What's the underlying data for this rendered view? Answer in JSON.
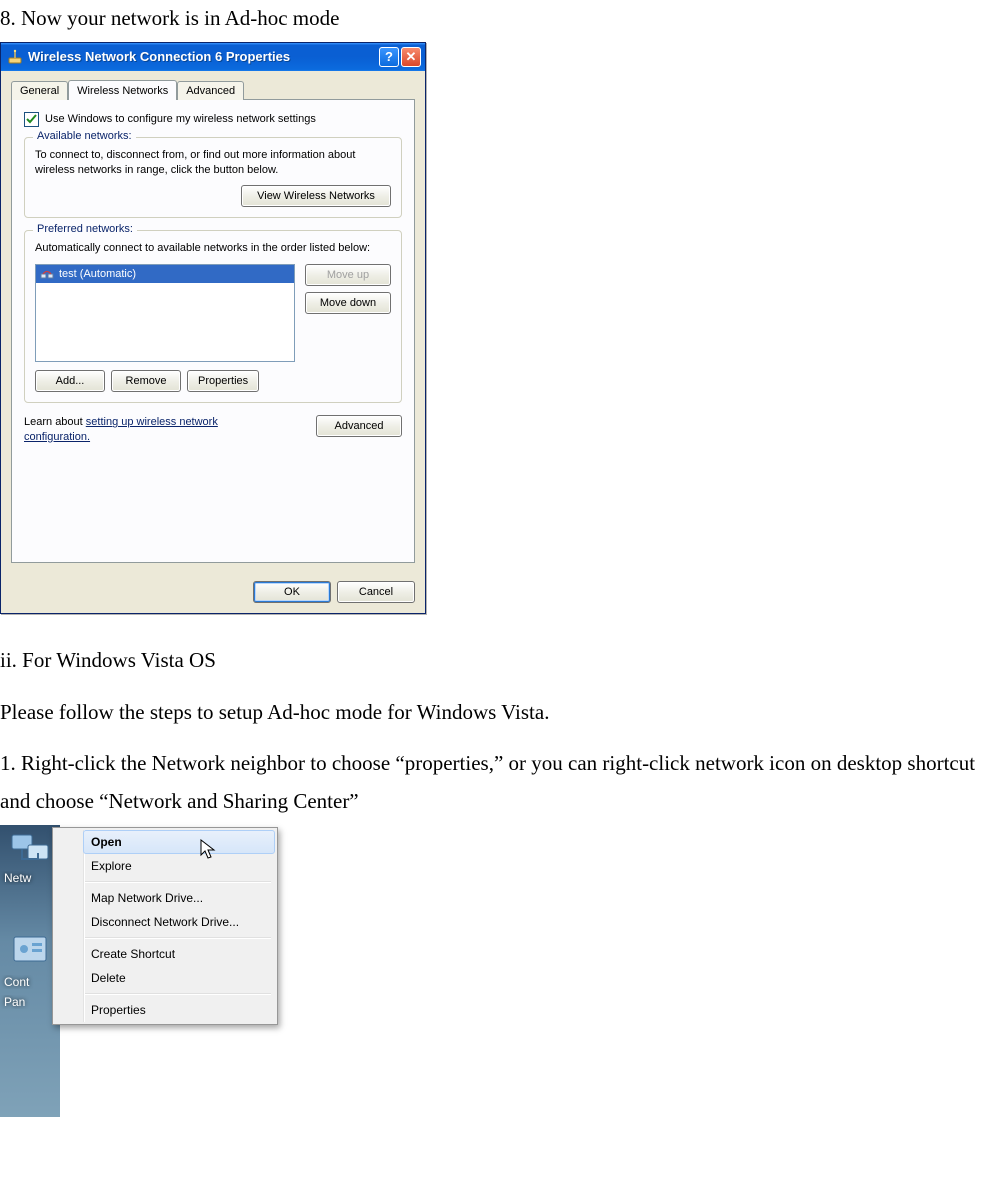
{
  "doc": {
    "step8": "8. Now your network is in Ad-hoc mode",
    "vista_heading": "ii. For Windows Vista OS",
    "vista_intro": "Please follow the steps to setup Ad-hoc mode for Windows Vista.",
    "vista_step1": "1. Right-click the Network neighbor to choose “properties,” or you can right-click network icon on desktop shortcut and choose “Network and Sharing Center”"
  },
  "xp_dialog": {
    "title": "Wireless Network Connection 6 Properties",
    "help_symbol": "?",
    "close_symbol": "✕",
    "tabs": {
      "general": "General",
      "wireless": "Wireless Networks",
      "advanced": "Advanced",
      "active_index": 1
    },
    "use_windows_checkbox": {
      "checked": true,
      "label": "Use Windows to configure my wireless network settings"
    },
    "available_group": {
      "title": "Available networks:",
      "text": "To connect to, disconnect from, or find out more information about wireless networks in range, click the button below.",
      "view_btn": "View Wireless Networks"
    },
    "preferred_group": {
      "title": "Preferred networks:",
      "text": "Automatically connect to available networks in the order listed below:",
      "list": [
        {
          "label": "test (Automatic)",
          "selected": true
        }
      ],
      "move_up": "Move up",
      "move_down": "Move down",
      "add": "Add...",
      "remove": "Remove",
      "props": "Properties"
    },
    "learn": {
      "prefix": "Learn about ",
      "link": "setting up wireless network configuration.",
      "advanced_btn": "Advanced"
    },
    "footer": {
      "ok": "OK",
      "cancel": "Cancel"
    }
  },
  "vista": {
    "desktop_icons": {
      "network_label": "Netw",
      "control_panel_label_line1": "Cont",
      "control_panel_label_line2": "Pan"
    },
    "menu": {
      "items": [
        {
          "label": "Open",
          "bold": true,
          "hover": true
        },
        {
          "label": "Explore",
          "bold": false,
          "hover": false
        },
        {
          "separator": true
        },
        {
          "label": "Map Network Drive...",
          "bold": false,
          "hover": false
        },
        {
          "label": "Disconnect Network Drive...",
          "bold": false,
          "hover": false
        },
        {
          "separator": true
        },
        {
          "label": "Create Shortcut",
          "bold": false,
          "hover": false
        },
        {
          "label": "Delete",
          "bold": false,
          "hover": false
        },
        {
          "separator": true
        },
        {
          "label": "Properties",
          "bold": false,
          "hover": false
        }
      ]
    }
  }
}
